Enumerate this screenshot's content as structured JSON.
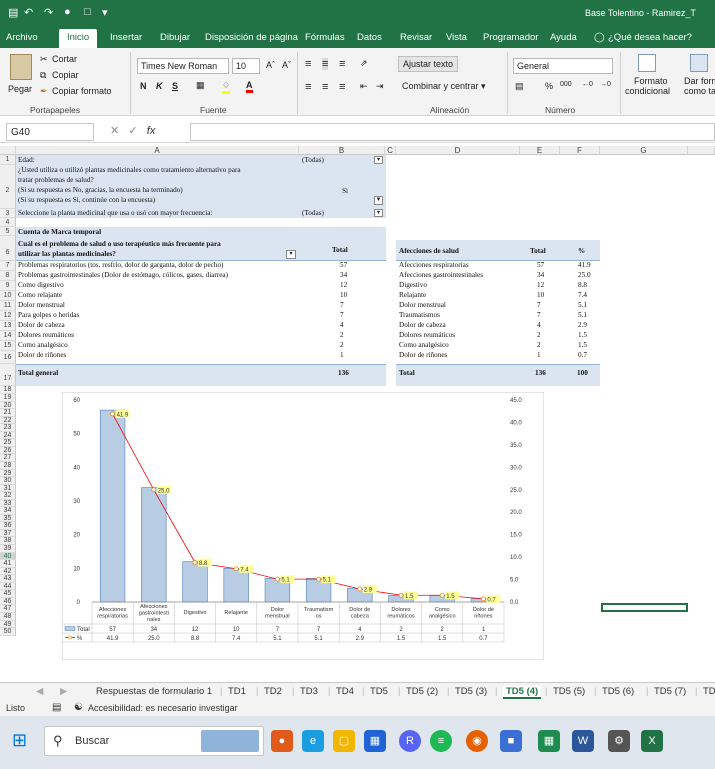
{
  "window": {
    "doc_title": "Base Tolentino - Ramirez_T"
  },
  "menu": {
    "tabs": [
      "Archivo",
      "Inicio",
      "Insertar",
      "Dibujar",
      "Disposición de página",
      "Fórmulas",
      "Datos",
      "Revisar",
      "Vista",
      "Programador",
      "Ayuda"
    ],
    "active_tab": "Inicio",
    "tell_me": "¿Qué desea hacer?"
  },
  "ribbon": {
    "paste_label": "Pegar",
    "cut_label": "Cortar",
    "copy_label": "Copiar",
    "format_painter_label": "Copiar formato",
    "clipboard_group": "Portapapeles",
    "font_name": "Times New Roman",
    "font_size": "10",
    "bold": "N",
    "italic": "K",
    "underline": "S",
    "font_group": "Fuente",
    "wrap_text": "Ajustar texto",
    "merge_center": "Combinar y centrar",
    "alignment_group": "Alineación",
    "number_format": "General",
    "percent": "%",
    "thousands": "000",
    "number_group": "Número",
    "conditional_format": "Formato",
    "conditional_format2": "condicional",
    "format_table": "Dar form",
    "format_table2": "como ta"
  },
  "formula_bar": {
    "name_box": "G40",
    "fx": "fx"
  },
  "columns": [
    "A",
    "B",
    "C",
    "D",
    "E",
    "F",
    "G"
  ],
  "rows": [
    "1",
    "2",
    "3",
    "4",
    "5",
    "6",
    "7",
    "8",
    "9",
    "10",
    "11",
    "12",
    "13",
    "14",
    "15",
    "16",
    "17",
    "18",
    "19",
    "20",
    "21",
    "22",
    "23",
    "24",
    "25",
    "26",
    "27",
    "28",
    "29",
    "30",
    "31",
    "32",
    "33",
    "34",
    "35",
    "36",
    "37",
    "38",
    "39",
    "40",
    "41",
    "42",
    "43",
    "44",
    "45",
    "46",
    "47",
    "48",
    "49",
    "50"
  ],
  "filters": {
    "r1_label": "Edad:",
    "r1_value": "(Todas)",
    "r2_line1": "¿Usted utiliza o utilizó plantas medicinales como tratamiento alternativo para",
    "r2_line2": "tratar problemas de salud?",
    "r2_line3": "(Si su respuesta es No, gracias, la encuesta ha terminado)",
    "r2_line4": "(Si su respuesta es Si, continúe con la encuesta)",
    "r2_value": "Si",
    "r3_label": "Seleccione la planta medicinal que usa o usó con mayor frecuencia:",
    "r3_value": "(Todas)"
  },
  "pivot": {
    "title": "Cuenta de Marca temporal",
    "header_line1": "Cuál es el problema de salud o uso terapéutico más frecuente para",
    "header_line2": "utilizar las plantas medicinales?",
    "header_total": "Total",
    "rows": [
      {
        "label": "Problemas respiratorios (tos, resfrío, dolor de garganta, dolor de pecho)",
        "value": "57"
      },
      {
        "label": "Problemas gastrointestinales (Dolor de estómago, cólicos, gases, diarrea)",
        "value": "34"
      },
      {
        "label": "Como digestivo",
        "value": "12"
      },
      {
        "label": "Como relajante",
        "value": "10"
      },
      {
        "label": "Dolor menstrual",
        "value": "7"
      },
      {
        "label": "Para golpes o heridas",
        "value": "7"
      },
      {
        "label": "Dolor de cabeza",
        "value": "4"
      },
      {
        "label": "Dolores reumáticos",
        "value": "2"
      },
      {
        "label": "Como analgésico",
        "value": "2"
      },
      {
        "label": "Dolor de riñones",
        "value": "1"
      }
    ],
    "grand_total_label": "Total general",
    "grand_total_value": "136"
  },
  "summary": {
    "header": [
      "Afecciones de salud",
      "Total",
      "%"
    ],
    "rows": [
      [
        "Afecciones respiratorias",
        "57",
        "41.9"
      ],
      [
        "Afecciones gastrointestinales",
        "34",
        "25.0"
      ],
      [
        "Digestivo",
        "12",
        "8.8"
      ],
      [
        "Relajante",
        "10",
        "7.4"
      ],
      [
        "Dolor menstrual",
        "7",
        "5.1"
      ],
      [
        "Traumatismos",
        "7",
        "5.1"
      ],
      [
        "Dolor de cabeza",
        "4",
        "2.9"
      ],
      [
        "Dolores reumáticos",
        "2",
        "1.5"
      ],
      [
        "Como analgésico",
        "2",
        "1.5"
      ],
      [
        "Dolor de riñones",
        "1",
        "0.7"
      ]
    ],
    "total_row": [
      "Total",
      "136",
      "100"
    ]
  },
  "chart_data": {
    "type": "bar",
    "categories": [
      [
        "Afecciones",
        "respiratorias"
      ],
      [
        "Afecciones",
        "gastrointesti",
        "nales"
      ],
      [
        "Digestivo"
      ],
      [
        "Relajante"
      ],
      [
        "Dolor",
        "menstrual"
      ],
      [
        "Traumatism",
        "os"
      ],
      [
        "Dolor de",
        "cabeza"
      ],
      [
        "Dolores",
        "reumáticos"
      ],
      [
        "Como",
        "analgésico"
      ],
      [
        "Dolor de",
        "riñones"
      ]
    ],
    "series": [
      {
        "name": "Total",
        "type": "bar",
        "axis": "left",
        "values": [
          57,
          34,
          12,
          10,
          7,
          7,
          4,
          2,
          2,
          1
        ],
        "labels": [
          "57",
          "34",
          "12",
          "10",
          "7",
          "7",
          "4",
          "2",
          "2",
          "1"
        ],
        "color": "#b8cce4"
      },
      {
        "name": "%",
        "type": "line",
        "axis": "right",
        "values": [
          41.9,
          25.0,
          8.8,
          7.4,
          5.1,
          5.1,
          2.9,
          1.5,
          1.5,
          0.7
        ],
        "labels": [
          "41.9",
          "25.0",
          "8.8",
          "7.4",
          "5.1",
          "5.1",
          "2.9",
          "1.5",
          "1.5",
          "0.7"
        ],
        "color": "#ff0000"
      }
    ],
    "y_left": {
      "min": 0,
      "max": 60,
      "ticks": [
        "0",
        "10",
        "20",
        "30",
        "40",
        "50",
        "60"
      ]
    },
    "y_right": {
      "min": 0,
      "max": 45,
      "ticks": [
        "0.0",
        "5.0",
        "10.0",
        "15.0",
        "20.0",
        "25.0",
        "30.0",
        "35.0",
        "40.0",
        "45.0"
      ]
    },
    "data_table": true,
    "legend": "data-table"
  },
  "sheet_tabs": [
    "Respuestas de formulario 1",
    "TD1",
    "TD2",
    "TD3",
    "TD4",
    "TD5",
    "TD5 (2)",
    "TD5 (3)",
    "TD5 (4)",
    "TD5 (5)",
    "TD5 (6)",
    "TD5 (7)",
    "TD"
  ],
  "active_sheet": "TD5 (4)",
  "status": {
    "ready": "Listo",
    "accessibility": "Accesibilidad: es necesario investigar"
  },
  "taskbar": {
    "search": "Buscar"
  },
  "colors": {
    "excel_green": "#217346",
    "pivot_blue": "#dbe5f1",
    "bar_fill": "#b8cce4",
    "line_red": "#ff0000"
  }
}
